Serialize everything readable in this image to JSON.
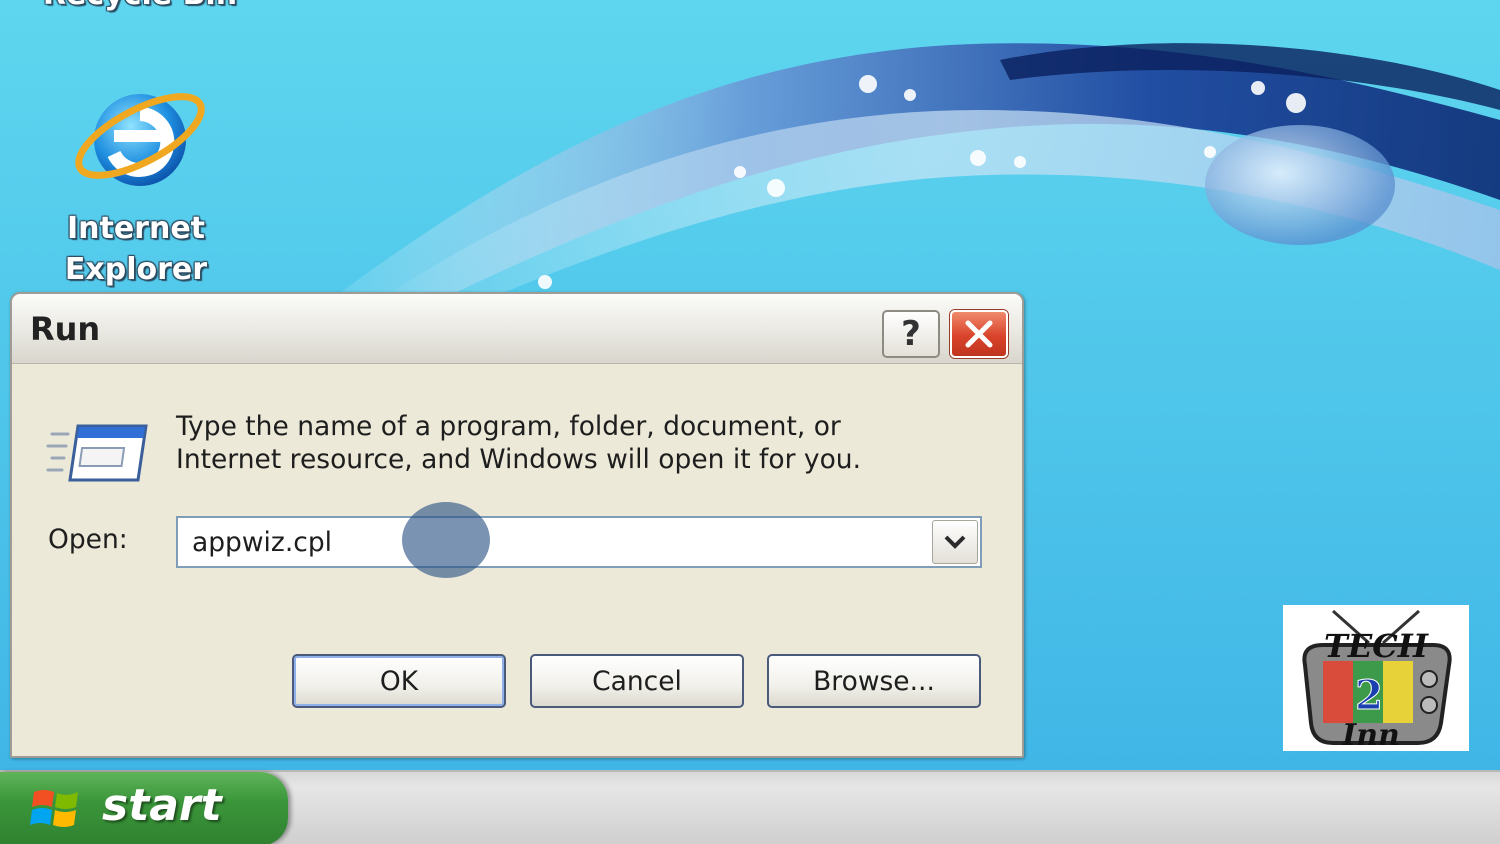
{
  "desktop": {
    "icons": [
      {
        "label": "Recycle Bin",
        "icon": "recycle-bin-icon"
      },
      {
        "label": "Internet\nExplorer",
        "icon": "internet-explorer-icon"
      }
    ]
  },
  "run_dialog": {
    "title": "Run",
    "help_label": "?",
    "prompt": "Type the name of a program, folder, document, or\nInternet resource, and Windows will open it for you.",
    "open_label": "Open:",
    "open_value": "appwiz.cpl",
    "buttons": {
      "ok": "OK",
      "cancel": "Cancel",
      "browse": "Browse..."
    }
  },
  "taskbar": {
    "start_label": "start"
  },
  "logo": {
    "text_top": "TECH",
    "text_mid": "2",
    "text_bottom": "Inn"
  },
  "colors": {
    "desktop_bg": "#4fc6ea",
    "dialog_bg": "#ece9d8",
    "close_red": "#d9432b",
    "start_green": "#3b963a"
  }
}
